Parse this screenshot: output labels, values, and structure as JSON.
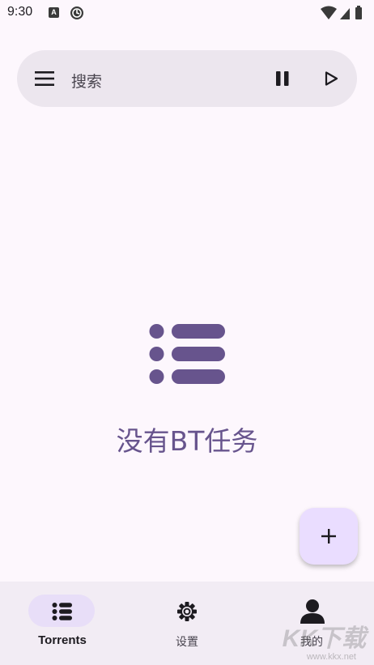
{
  "status_bar": {
    "time": "9:30",
    "notification_icon_a_label": "A"
  },
  "search_bar": {
    "placeholder": "搜索"
  },
  "empty_state": {
    "message": "没有BT任务"
  },
  "bottom_nav": {
    "items": [
      {
        "label": "Torrents",
        "icon": "list-icon",
        "active": true
      },
      {
        "label": "设置",
        "icon": "gear-icon",
        "active": false
      },
      {
        "label": "我的",
        "icon": "person-icon",
        "active": false
      }
    ]
  },
  "colors": {
    "accent": "#67548D",
    "background": "#FDF7FD",
    "search_bg": "#ECE6EE",
    "fab_bg": "#EADDFF",
    "nav_bg": "#F2ECF4",
    "nav_indicator": "#E8DEF8"
  },
  "watermark": {
    "text": "KK下载",
    "sub": "www.kkx.net"
  }
}
